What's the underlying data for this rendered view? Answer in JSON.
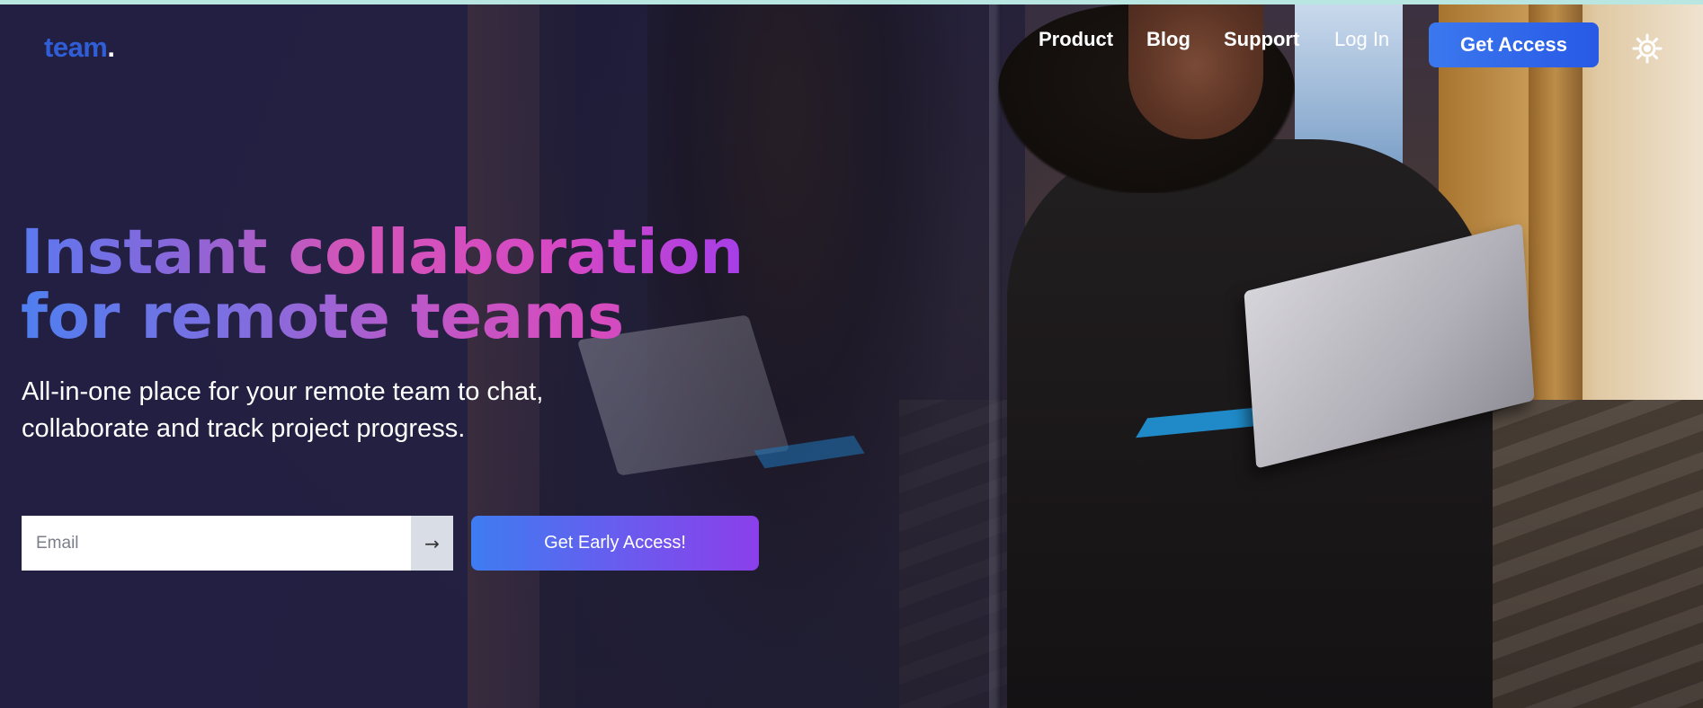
{
  "brand": {
    "name": "team",
    "dot": "."
  },
  "nav": {
    "links": [
      "Product",
      "Blog",
      "Support",
      "Log In"
    ],
    "cta": "Get Access",
    "theme_icon": "sun-icon"
  },
  "hero": {
    "headline_line1": "Instant collaboration",
    "headline_line2": "for remote teams",
    "subheadline": "All-in-one place for your remote team to chat, collaborate and track project progress."
  },
  "signup": {
    "email_placeholder": "Email",
    "submit_symbol": "→",
    "button": "Get Early Access!"
  },
  "colors": {
    "background": "#221f42",
    "brand_blue": "#2f5ed6",
    "cta_blue": "#3b78ee",
    "gradient_purple": "#8b3fea",
    "gradient_pink": "#d648c4"
  }
}
